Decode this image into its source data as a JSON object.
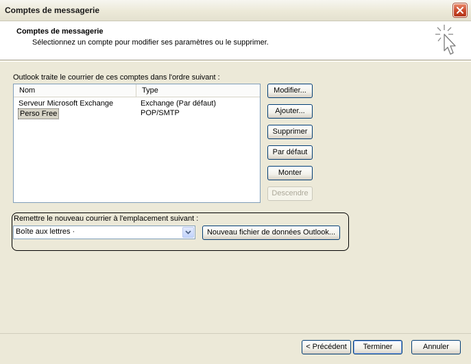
{
  "window": {
    "title": "Comptes de messagerie"
  },
  "header": {
    "title": "Comptes de messagerie",
    "subtitle": "Sélectionnez un compte pour modifier ses paramètres ou le supprimer."
  },
  "accounts": {
    "caption": "Outlook traite le courrier de ces comptes dans l'ordre suivant :",
    "columns": [
      "Nom",
      "Type"
    ],
    "rows": [
      {
        "name": "Serveur Microsoft Exchange",
        "type": "Exchange (Par défaut)"
      },
      {
        "name": "Perso Free",
        "type": "POP/SMTP",
        "selected": true
      }
    ]
  },
  "side_buttons": {
    "modify": "Modifier...",
    "add": "Ajouter...",
    "delete": "Supprimer",
    "set_default": "Par défaut",
    "move_up": "Monter",
    "move_down": "Descendre"
  },
  "delivery": {
    "caption": "Remettre le nouveau courrier à l'emplacement suivant :",
    "selected": "Boîte aux lettres ·",
    "new_data_file": "Nouveau fichier de données Outlook..."
  },
  "footer": {
    "back": "< Précédent",
    "finish": "Terminer",
    "cancel": "Annuler"
  },
  "colors": {
    "border_blue": "#003c74",
    "face": "#ece9d8",
    "close_red": "#c8472a"
  }
}
